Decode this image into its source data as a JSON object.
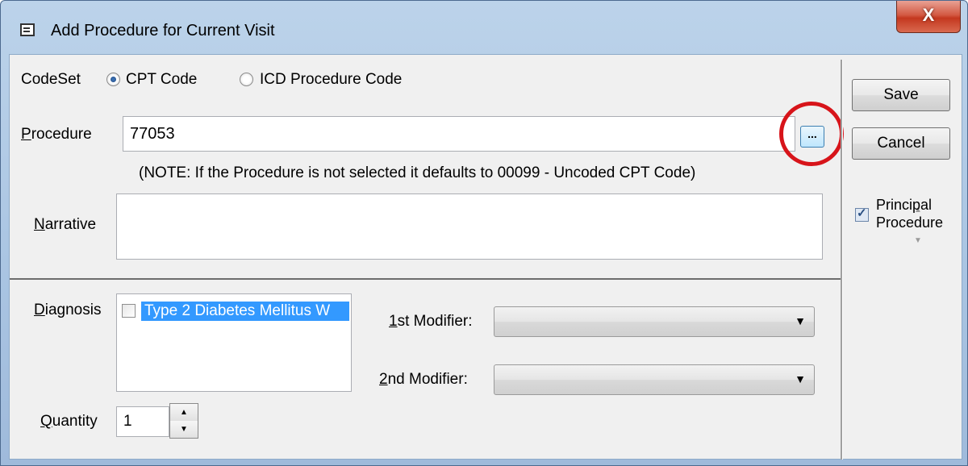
{
  "window": {
    "title": "Add Procedure for Current Visit",
    "close_icon": "x-close-icon",
    "close_glyph": "X"
  },
  "codeset": {
    "label": "CodeSet",
    "options": [
      "CPT Code",
      "ICD Procedure Code"
    ],
    "selected": "CPT Code"
  },
  "procedure": {
    "label_first": "P",
    "label_rest": "rocedure",
    "value": "77053",
    "browse_label": "...",
    "note": "(NOTE: If the Procedure is not selected it defaults to 00099 - Uncoded CPT Code)"
  },
  "narrative": {
    "label_first": "N",
    "label_rest": "arrative",
    "value": ""
  },
  "diagnosis": {
    "label_first": "D",
    "label_rest": "iagnosis",
    "items": [
      {
        "text": "Type 2 Diabetes Mellitus W",
        "checked": false,
        "selected": true
      }
    ]
  },
  "modifiers": {
    "first_label_u": "1",
    "first_label_rest": "st Modifier:",
    "first_value": "",
    "second_label_u": "2",
    "second_label_rest": "nd Modifier:",
    "second_value": ""
  },
  "quantity": {
    "label_first": "Q",
    "label_rest": "uantity",
    "value": "1"
  },
  "side_panel": {
    "save_label": "Save",
    "cancel_label": "Cancel",
    "principal_line1": "Principal",
    "principal_line2": "Procedure",
    "principal_checked": true
  },
  "colors": {
    "highlight": "#3399ff",
    "annotation_circle": "#d7141a",
    "close_button": "#c4381f"
  }
}
